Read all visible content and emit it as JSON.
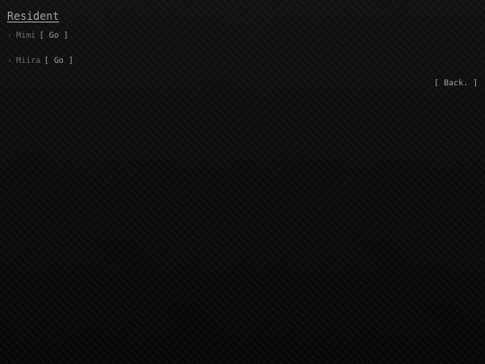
{
  "screen": {
    "title": "Resident"
  },
  "choices": [
    {
      "chevron": "›",
      "name": "Mimi",
      "button_open": "[",
      "button_label": "Go",
      "button_close": "]"
    },
    {
      "chevron": "›",
      "name": "Miira",
      "button_open": "[",
      "button_label": "Go",
      "button_close": "]"
    }
  ],
  "back": {
    "open": "[",
    "label": "Back.",
    "close": "]"
  },
  "colors": {
    "background": "#0b0b0b",
    "text": "#9a9a9a",
    "dim": "#6f6f6f"
  }
}
